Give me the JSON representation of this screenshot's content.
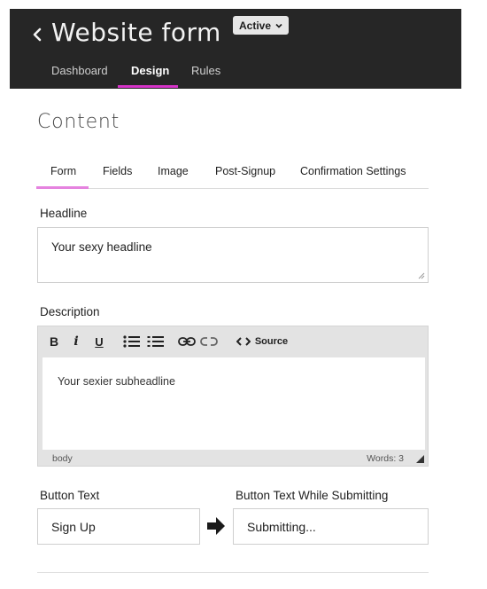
{
  "header": {
    "title": "Website form",
    "status": "Active",
    "back_icon": "chevron-left-icon",
    "tabs": [
      {
        "label": "Dashboard",
        "active": false
      },
      {
        "label": "Design",
        "active": true
      },
      {
        "label": "Rules",
        "active": false
      }
    ],
    "accent_color": "#d633c8",
    "background_color": "#262626"
  },
  "content": {
    "title": "Content",
    "tabs": [
      {
        "label": "Form",
        "active": true
      },
      {
        "label": "Fields",
        "active": false
      },
      {
        "label": "Image",
        "active": false
      },
      {
        "label": "Post-Signup",
        "active": false
      },
      {
        "label": "Confirmation Settings",
        "active": false
      }
    ]
  },
  "form": {
    "headline_label": "Headline",
    "headline_value": "Your sexy headline",
    "description_label": "Description",
    "editor": {
      "toolbar": {
        "bold": "B",
        "italic": "i",
        "underline": "U",
        "source": "Source"
      },
      "content": "Your sexier subheadline",
      "path": "body",
      "words": "Words: 3"
    },
    "button_text_label": "Button Text",
    "button_text_value": "Sign Up",
    "submitting_label": "Button Text While Submitting",
    "submitting_value": "Submitting..."
  }
}
